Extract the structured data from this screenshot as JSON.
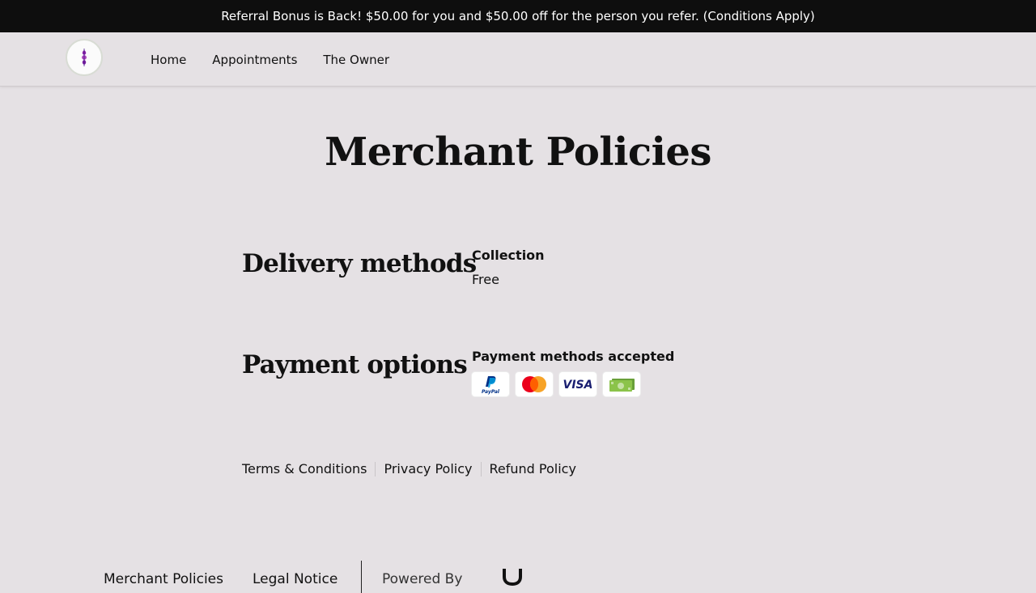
{
  "announcement": "Referral Bonus is Back! $50.00 for you and $50.00 off for the person you refer. (Conditions Apply)",
  "header": {
    "logo_icon": "orchid-logo-icon",
    "nav": [
      "Home",
      "Appointments",
      "The Owner"
    ]
  },
  "page": {
    "title": "Merchant Policies"
  },
  "delivery": {
    "heading": "Delivery methods",
    "method_name": "Collection",
    "method_price": "Free"
  },
  "payment": {
    "heading": "Payment options",
    "label": "Payment methods accepted",
    "methods": [
      {
        "name": "PayPal",
        "icon": "paypal-icon"
      },
      {
        "name": "Mastercard",
        "icon": "mastercard-icon"
      },
      {
        "name": "VISA",
        "icon": "visa-icon"
      },
      {
        "name": "Cash",
        "icon": "cash-icon"
      }
    ]
  },
  "policy_links": [
    "Terms & Conditions",
    "Privacy Policy",
    "Refund Policy"
  ],
  "footer": {
    "links": [
      "Merchant Policies",
      "Legal Notice"
    ],
    "powered_by": "Powered By",
    "brand_icon": "brand-logo-icon"
  },
  "colors": {
    "background": "#e5e1e4",
    "announcement_bar": "#0e0e0e",
    "mastercard_red": "#eb001b",
    "mastercard_orange": "#f79e1b",
    "visa_blue": "#1a1f71",
    "paypal_blue": "#003087",
    "cash_green": "#8bc34a"
  }
}
